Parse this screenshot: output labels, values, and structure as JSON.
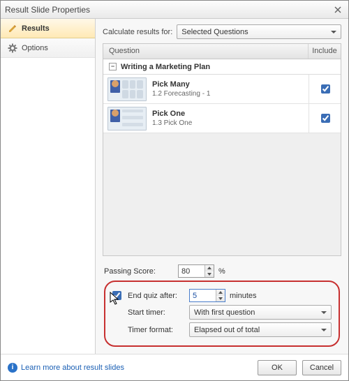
{
  "window": {
    "title": "Result Slide Properties"
  },
  "sidebar": {
    "tabs": [
      {
        "label": "Results"
      },
      {
        "label": "Options"
      }
    ]
  },
  "calc": {
    "label": "Calculate results for:",
    "selected": "Selected Questions"
  },
  "questions": {
    "columns": {
      "question": "Question",
      "include": "Include"
    },
    "group_label": "Writing a Marketing Plan",
    "items": [
      {
        "title": "Pick Many",
        "sub": "1.2 Forecasting - 1",
        "included": true
      },
      {
        "title": "Pick One",
        "sub": "1.3 Pick One",
        "included": true
      }
    ]
  },
  "passing": {
    "label": "Passing Score:",
    "value": "80",
    "unit": "%"
  },
  "timer": {
    "end_label": "End quiz after:",
    "end_checked": true,
    "minutes_value": "5",
    "minutes_unit": "minutes",
    "start_label": "Start timer:",
    "start_value": "With first question",
    "format_label": "Timer format:",
    "format_value": "Elapsed out of total"
  },
  "footer": {
    "help": "Learn more about result slides",
    "ok": "OK",
    "cancel": "Cancel"
  }
}
